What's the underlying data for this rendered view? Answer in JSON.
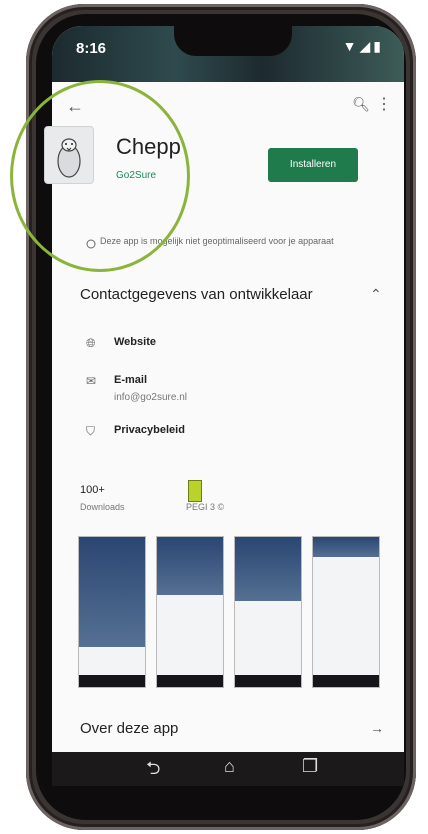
{
  "status": {
    "time": "8:16",
    "icons": "▼◢▮"
  },
  "appbar": {
    "back_icon": "arrow-left-icon",
    "search_icon": "search-icon",
    "more_icon": "more-vert-icon"
  },
  "app": {
    "name": "Chepp",
    "developer": "Go2Sure",
    "install_label": "Installeren",
    "compat_text": "Deze app is mogelijk niet geoptimaliseerd voor je apparaat"
  },
  "contact": {
    "title": "Contactgegevens van ontwikkelaar",
    "rows": [
      {
        "label": "Website"
      },
      {
        "label": "E-mail",
        "value": "info@go2sure.nl"
      },
      {
        "label": "Privacybeleid"
      }
    ]
  },
  "stats": {
    "downloads": "100+",
    "downloads_label": "Downloads",
    "rating_label": "PEGI 3 ©"
  },
  "about": {
    "title": "Over deze app"
  },
  "colors": {
    "install": "#1f7a4c",
    "developer": "#1a8a5a",
    "annotation": "#8ab53a"
  }
}
